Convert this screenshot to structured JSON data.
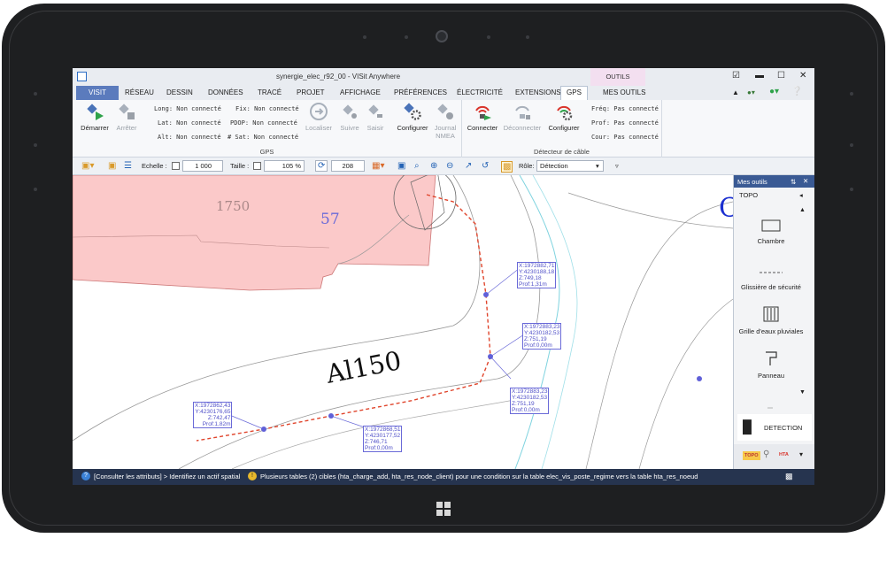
{
  "window": {
    "title": "synergie_elec_r92_00 - VISit Anywhere",
    "context_tab": "OUTILS"
  },
  "tabs": [
    "VISIT",
    "RÉSEAU",
    "DESSIN",
    "DONNÉES",
    "TRACÉ",
    "PROJET",
    "AFFICHAGE",
    "PRÉFÉRENCES",
    "ÉLECTRICITÉ",
    "EXTENSIONS",
    "GPS",
    "MES OUTILS"
  ],
  "ribbon": {
    "gps": {
      "label": "GPS",
      "start": "Démarrer",
      "stop": "Arrêter",
      "long": "Long: Non connecté",
      "lat": "Lat: Non connecté",
      "alt": "Alt: Non connecté",
      "fix": "Fix: Non connecté",
      "pdop": "PDOP: Non connecté",
      "sat": "# Sat: Non connecté",
      "locate": "Localiser",
      "follow": "Suivre",
      "enter": "Saisir",
      "configure": "Configurer",
      "journal": "Journal NMEA"
    },
    "cable": {
      "label": "Détecteur de câble",
      "connect": "Connecter",
      "disconnect": "Déconnecter",
      "configure": "Configurer",
      "freq": "Fréq: Pas connecté",
      "prof": "Prof: Pas connecté",
      "cour": "Cour: Pas connecté"
    }
  },
  "toolbar": {
    "scale_label": "Echelle :",
    "scale_value": "1 000",
    "size_label": "Taille :",
    "size_value": "105 %",
    "angle_value": "208",
    "role_label": "Rôle:",
    "role_value": "Détection"
  },
  "map": {
    "parcel_number": "1750",
    "parcel_id": "57",
    "street": "Al150",
    "edge_letter": "C",
    "labels": [
      {
        "text": "X:1972882,71\nY:4230188,18\nZ:749,18\nProf:1,31m"
      },
      {
        "text": "X:1972883,23\nY:4230182,53\nZ:751,19\nProf:0,00m"
      },
      {
        "text": "X:1972883,23\nY:4230182,53\nZ:751,19\nProf:0,00m"
      },
      {
        "text": "X:1972862,43\nY:4230176,65\nZ:742,47\nProf:1,82m"
      },
      {
        "text": "X:1972868,51\nY:4230177,52\nZ:746,71\nProf:0,00m"
      }
    ]
  },
  "panel": {
    "title": "Mes outils",
    "section": "TOPO",
    "items": [
      "Chambre",
      "Glissière de sécurité",
      "Grille d'eaux pluviales",
      "Panneau"
    ],
    "detection": "DETECTION",
    "topo_badge": "TOPO",
    "hta_badge": "HTA"
  },
  "status": {
    "left": "[Consulter les attributs] > Identifiez un actif spatial",
    "message": "Plusieurs tables (2) cibles (hta_charge_add, hta_res_node_client) pour une condition sur la table elec_vis_poste_regime vers la table hta_res_noeud"
  },
  "colors": {
    "parcel": "#fbc9c9",
    "route": "#e0452c",
    "node": "#6060d8",
    "accent": "#5b7bbd"
  }
}
